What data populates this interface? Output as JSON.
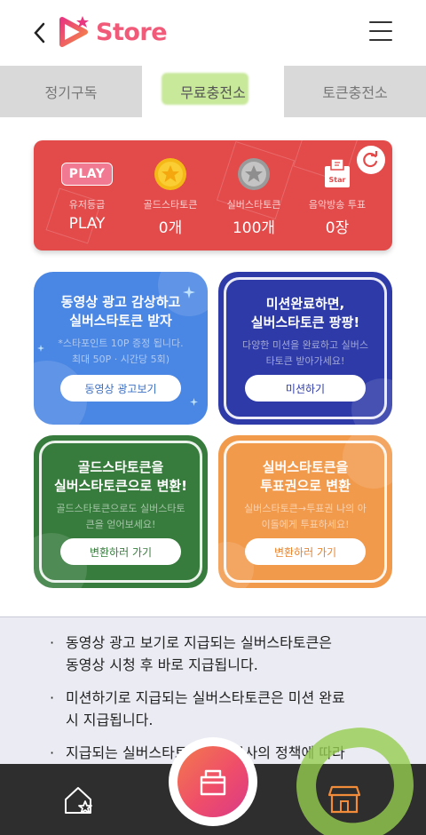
{
  "header": {
    "logo_text": "Store"
  },
  "tabs": [
    {
      "label": "정기구독",
      "active": false
    },
    {
      "label": "무료충전소",
      "active": true
    },
    {
      "label": "토큰충전소",
      "active": false
    }
  ],
  "status": {
    "stats": [
      {
        "badge": "PLAY",
        "label": "유저등급",
        "value": "PLAY",
        "icon": "play-badge"
      },
      {
        "label": "골드스타토큰",
        "value": "0개",
        "icon": "gold-star-token-icon"
      },
      {
        "label": "실버스타토큰",
        "value": "100개",
        "icon": "silver-star-token-icon"
      },
      {
        "badge": "Star",
        "label": "음악방송 투표",
        "value": "0장",
        "icon": "vote-ticket-icon"
      }
    ]
  },
  "cards": [
    {
      "title1": "동영상 광고 감상하고",
      "title2": "실버스타토큰 받자",
      "desc1": "*스타포인트 10P 증정 됩니다.",
      "desc2": "최대 50P · 시간당 5회)",
      "button": "동영상 광고보기",
      "color": "#4a86e3"
    },
    {
      "title1": "미션완료하면,",
      "title2": "실버스타토큰 팡팡!",
      "desc1": "다양한 미션을 완료하고 실버스",
      "desc2": "타토큰 받아가세요!",
      "button": "미션하기",
      "color": "#2d3aa8"
    },
    {
      "title1": "골드스타토큰을",
      "title2": "실버스타토큰으로 변환!",
      "desc1": "골드스타토큰으로도 실버스타토",
      "desc2": "큰을 얻어보세요!",
      "button": "변환하러 가기",
      "color": "#377c3d"
    },
    {
      "title1": "실버스타토큰을",
      "title2": "투표권으로 변환",
      "desc1": "실버스타토큰→투표권 나의 아",
      "desc2": "이돌에게 투표하세요!",
      "button": "변환하러 가기",
      "color": "#f29a4c"
    }
  ],
  "info": {
    "items": [
      {
        "line1": "동영상 광고 보기로 지급되는 실버스타토큰은",
        "line2": "동영상 시청 후 바로 지급됩니다."
      },
      {
        "line1": "미션하기로 지급되는 실버스타토큰은 미션 완료",
        "line2": "시 지급됩니다."
      },
      {
        "line1": "지급되는 실버스타토큰은 제공사의 정책에 따라",
        "line2": ""
      }
    ]
  },
  "colors": {
    "accent": "#f15a78",
    "status_card": "#e34a4a",
    "nav_bg": "#2e2e2e",
    "store_icon": "#f28c3a"
  }
}
